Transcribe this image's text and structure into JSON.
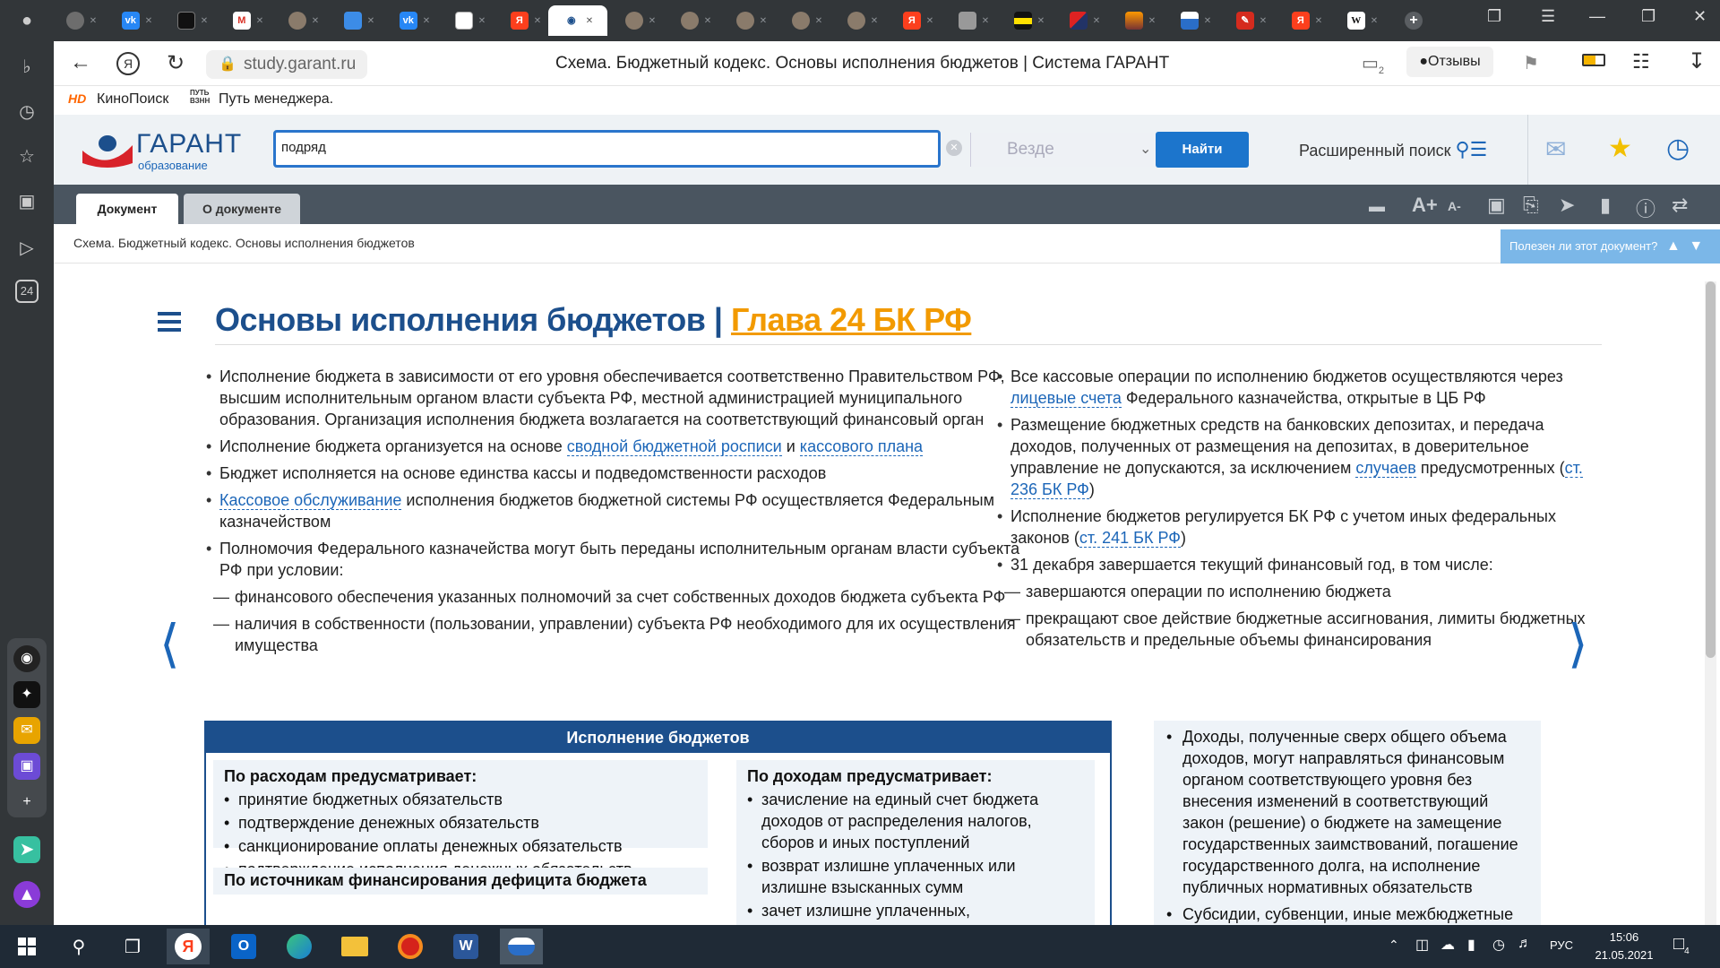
{
  "browser": {
    "tabs": [
      {
        "icon": "avatar"
      },
      {
        "icon": "vk",
        "label": "vk"
      },
      {
        "icon": "screen"
      },
      {
        "icon": "gmail",
        "label": "M"
      },
      {
        "icon": "avatar"
      },
      {
        "icon": "chat"
      },
      {
        "icon": "vk",
        "label": "vk"
      },
      {
        "icon": "doc"
      },
      {
        "icon": "yandex",
        "label": "Я"
      },
      {
        "icon": "garant",
        "active": true
      },
      {
        "icon": "avatar"
      },
      {
        "icon": "avatar"
      },
      {
        "icon": "avatar"
      },
      {
        "icon": "avatar"
      },
      {
        "icon": "avatar"
      },
      {
        "icon": "yandex",
        "label": "Я"
      },
      {
        "icon": "stack"
      },
      {
        "icon": "yellowbar"
      },
      {
        "icon": "flag"
      },
      {
        "icon": "sunset"
      },
      {
        "icon": "bluewave"
      },
      {
        "icon": "pdf"
      },
      {
        "icon": "yandex",
        "label": "Я"
      },
      {
        "icon": "wiki",
        "label": "W"
      }
    ],
    "url": "study.garant.ru",
    "page_title": "Схема. Бюджетный кодекс. Основы исполнения бюджетов | Система ГАРАНТ",
    "feedback_label": "Отзывы",
    "tab_counter": "2",
    "bookmarks": [
      "КиноПоиск",
      "Путь менеджера."
    ],
    "bookmark_icon_text": "ПУТЬ ВЗНН",
    "sidebar_counter": "24"
  },
  "garant": {
    "logo_title": "ГАРАНТ",
    "logo_subtitle": "образование",
    "search_value": "подряд",
    "scope_value": "Везде",
    "find_label": "Найти",
    "advanced_search_label": "Расширенный поиск",
    "doc_tabs": [
      "Документ",
      "О документе"
    ],
    "font_increase_label": "A+",
    "font_decrease_label": "A-",
    "breadcrumb": "Схема. Бюджетный кодекс. Основы исполнения бюджетов",
    "useful_label": "Полезен ли этот документ?"
  },
  "doc": {
    "title": "Основы исполнения бюджетов",
    "title_sep": "|",
    "title_link": "Глава 24 БК РФ",
    "left": [
      {
        "text": "Исполнение бюджета в зависимости от его уровня обеспечивается соответственно Правительством РФ, высшим исполнительным органом власти субъекта РФ, местной администрацией муниципального образования. Организация исполнения бюджета возлагается на соответствующий финансовый орган"
      },
      {
        "p1": "Исполнение бюджета организуется на основе ",
        "l1": "сводной бюджетной росписи",
        "p2": " и ",
        "l2": "кассового плана"
      },
      {
        "text": "Бюджет исполняется на основе единства кассы и подведомственности расходов"
      },
      {
        "l1": "Кассовое обслуживание",
        "p1": " исполнения бюджетов бюджетной системы РФ осуществляется Федеральным казначейством"
      },
      {
        "text": "Полномочия Федерального казначейства могут быть переданы исполнительным органам власти субъекта РФ при условии:"
      },
      {
        "sub": "финансового обеспечения указанных полномочий за счет собственных доходов бюджета субъекта РФ"
      },
      {
        "sub": "наличия в собственности (пользовании, управлении) субъекта РФ необходимого для их осуществления имущества"
      }
    ],
    "right": [
      {
        "p1": "Все кассовые операции по исполнению бюджетов осуществляются через ",
        "l1": "лицевые счета",
        "p2": " Федерального казначейства, открытые в ЦБ РФ"
      },
      {
        "p1": "Размещение бюджетных средств на банковских депозитах, и передача доходов, полученных от размещения на депозитах, в доверительное управление не допускаются, за исключением ",
        "l1": "случаев",
        "p2": " предусмотренных (",
        "l2": "ст. 236 БК РФ",
        "p3": ")"
      },
      {
        "p1": "Исполнение бюджетов регулируется БК РФ с учетом иных федеральных законов (",
        "l1": "ст. 241 БК РФ",
        "p2": ")"
      },
      {
        "text": "31 декабря завершается текущий финансовый год, в том числе:"
      },
      {
        "sub": "завершаются операции по исполнению бюджета"
      },
      {
        "sub": "прекращают свое действие бюджетные ассигнования, лимиты бюджетных обязательств и предельные объемы финансирования"
      }
    ],
    "box_title": "Исполнение бюджетов",
    "expenses_title": "По расходам предусматривает:",
    "expenses": [
      "принятие бюджетных обязательств",
      "подтверждение денежных обязательств",
      "санкционирование оплаты денежных обязательств",
      "подтверждение исполнения денежных обязательств"
    ],
    "sources_title": "По источникам финансирования дефицита бюджета",
    "revenue_title": "По доходам предусматривает:",
    "revenue": [
      "зачисление на единый счет бюджета доходов от распределения налогов, сборов и иных поступлений",
      "возврат излишне уплаченных или излишне взысканных сумм",
      "зачет излишне уплаченных,"
    ],
    "side_items": [
      "Доходы, полученные сверх общего объема доходов, могут направляться финансовым органом соответствующего уровня без внесения изменений в соответствующий закон (решение) о бюджете на замещение государственных заимствований, погашение государственного долга, на исполнение публичных нормативных обязательств",
      "Субсидии, субвенции, иные межбюджетные"
    ]
  },
  "taskbar": {
    "time": "15:06",
    "date": "21.05.2021",
    "lang": "РУС",
    "notif_count": "4"
  }
}
